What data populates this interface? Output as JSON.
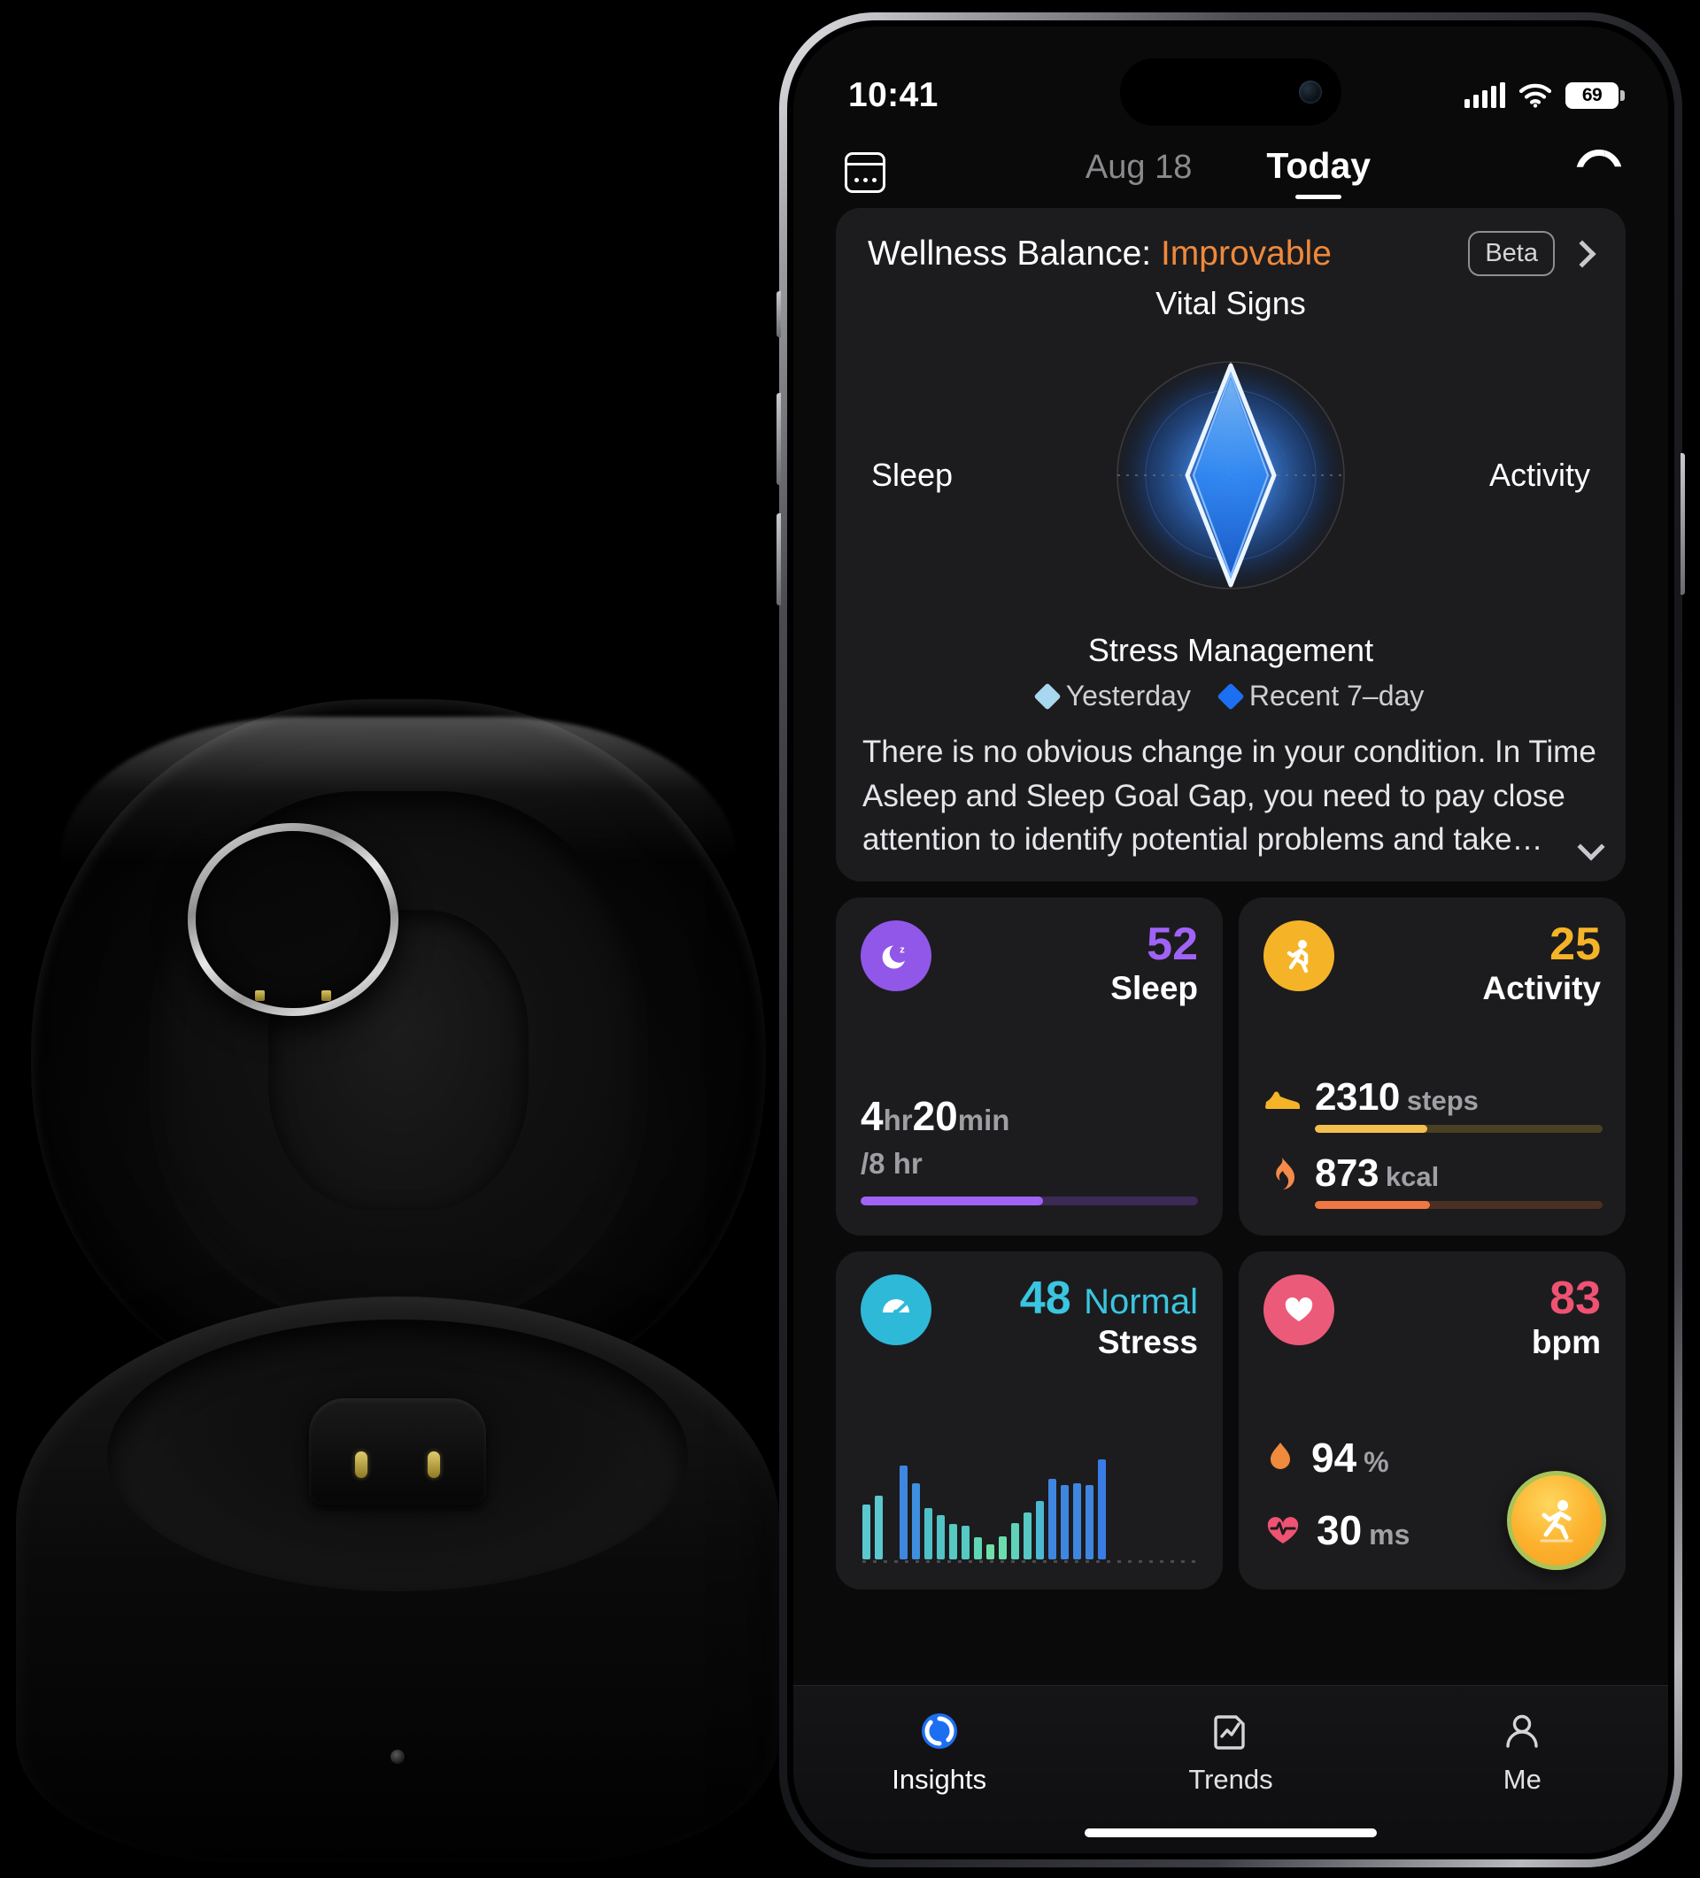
{
  "statusbar": {
    "time": "10:41",
    "battery": "69",
    "signal_icon": "cellular-signal-icon",
    "wifi_icon": "wifi-icon"
  },
  "nav": {
    "calendar_icon": "calendar-icon",
    "date_tab": "Aug 18",
    "today_tab": "Today",
    "sync_icon": "sync-refresh-icon"
  },
  "wellness": {
    "title_prefix": "Wellness Balance: ",
    "status": "Improvable",
    "status_color": "#f0893a",
    "beta_badge": "Beta",
    "chevron_icon": "chevron-right-icon",
    "expand_icon": "chevron-down-icon",
    "description": "There is no obvious change in your condition. In Time Asleep and Sleep Goal Gap, you need to pay close attention to identify potential problems and take…",
    "legend": [
      {
        "label": "Yesterday",
        "color": "#a8d8ef"
      },
      {
        "label": "Recent 7–day",
        "color": "#1d6ff2"
      }
    ]
  },
  "chart_data": {
    "type": "radar",
    "title": "Wellness Balance",
    "categories": [
      "Vital Signs",
      "Activity",
      "Stress Management",
      "Sleep"
    ],
    "series": [
      {
        "name": "Yesterday",
        "color": "#cfeaf8",
        "values": [
          96,
          38,
          95,
          38
        ]
      },
      {
        "name": "Recent 7–day",
        "color": "#1d6ff2",
        "values": [
          88,
          33,
          86,
          33
        ]
      }
    ],
    "rmax": 100,
    "grid": true,
    "legend_position": "bottom"
  },
  "cards": {
    "sleep": {
      "name": "Sleep",
      "score": "52",
      "score_color": "#a063f5",
      "icon": "moon-sleep-icon",
      "icon_bg": "#9157e8",
      "hours": "4",
      "hours_unit": "hr",
      "minutes": "20",
      "minutes_unit": "min",
      "goal": "/8 hr",
      "progress_pct": 54,
      "progress_color": "#a063f5"
    },
    "activity": {
      "name": "Activity",
      "score": "25",
      "score_color": "#f5b428",
      "icon": "running-person-icon",
      "icon_bg": "#f5b428",
      "rows": [
        {
          "icon": "sneaker-icon",
          "icon_color": "#f5b428",
          "value": "2310",
          "unit": "steps",
          "progress_pct": 39,
          "color": "#f3bf4e"
        },
        {
          "icon": "flame-icon",
          "icon_color": "#f58a4b",
          "value": "873",
          "unit": "kcal",
          "progress_pct": 40,
          "color": "#f07842"
        }
      ]
    },
    "stress": {
      "name": "Stress",
      "score": "48",
      "level": "Normal",
      "score_color": "#3ac5e0",
      "icon": "stress-gauge-icon",
      "icon_bg": "#2eb9d9",
      "bars": [
        {
          "h": 52,
          "c": "#5bc8cf"
        },
        {
          "h": 60,
          "c": "#5bc8cf"
        },
        {
          "h": 0,
          "c": "#000000"
        },
        {
          "h": 88,
          "c": "#3f86e0"
        },
        {
          "h": 72,
          "c": "#3f8fe0"
        },
        {
          "h": 48,
          "c": "#4fc0c8"
        },
        {
          "h": 42,
          "c": "#52c4c6"
        },
        {
          "h": 33,
          "c": "#55c9c2"
        },
        {
          "h": 32,
          "c": "#55c9c2"
        },
        {
          "h": 21,
          "c": "#5fd6b6"
        },
        {
          "h": 14,
          "c": "#6fe0a8"
        },
        {
          "h": 22,
          "c": "#6bdcae"
        },
        {
          "h": 34,
          "c": "#5fd2ba"
        },
        {
          "h": 44,
          "c": "#56c9c4"
        },
        {
          "h": 55,
          "c": "#4cb9d4"
        },
        {
          "h": 76,
          "c": "#3f86e0"
        },
        {
          "h": 70,
          "c": "#3f86e0"
        },
        {
          "h": 72,
          "c": "#3f86e0"
        },
        {
          "h": 70,
          "c": "#3f86e0"
        },
        {
          "h": 94,
          "c": "#3a7ce6"
        }
      ]
    },
    "heart": {
      "name": "bpm",
      "score": "83",
      "score_color": "#ef5273",
      "icon": "heart-icon",
      "icon_bg": "#ec5a79",
      "rows": [
        {
          "icon": "blood-oxygen-drop-icon",
          "icon_color": "#f08a3c",
          "value": "94",
          "unit": "%"
        },
        {
          "icon": "hrv-heartbeat-icon",
          "icon_color": "#ef5273",
          "value": "30",
          "unit": "ms"
        }
      ],
      "fab_icon": "workout-run-icon"
    }
  },
  "tabbar": [
    {
      "label": "Insights",
      "icon": "insights-ring-icon",
      "active": true
    },
    {
      "label": "Trends",
      "icon": "trends-chart-icon",
      "active": false
    },
    {
      "label": "Me",
      "icon": "person-profile-icon",
      "active": false
    }
  ]
}
